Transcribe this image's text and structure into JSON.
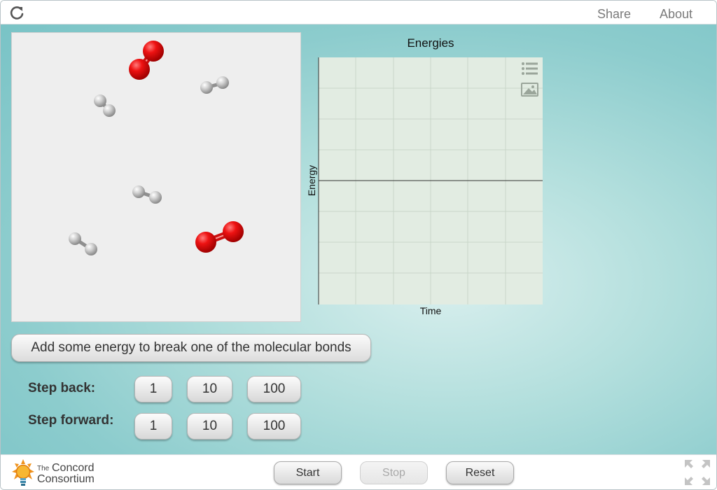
{
  "topbar": {
    "share_label": "Share",
    "about_label": "About"
  },
  "chart": {
    "title": "Energies",
    "xlabel": "Time",
    "ylabel": "Energy"
  },
  "chart_data": {
    "type": "line",
    "title": "Energies",
    "xlabel": "Time",
    "ylabel": "Energy",
    "series": [],
    "grid": true
  },
  "controls": {
    "action_label": "Add some energy to break one of the molecular bonds",
    "step_back_label": "Step back:",
    "step_forward_label": "Step forward:",
    "step_values": [
      "1",
      "10",
      "100"
    ]
  },
  "bottombar": {
    "logo_the": "The",
    "logo_concord": "Concord",
    "logo_consortium": "Consortium",
    "start_label": "Start",
    "stop_label": "Stop",
    "reset_label": "Reset"
  },
  "colors": {
    "oxygen": "#e01010",
    "hydrogen": "#bdbdbd",
    "background": "#8ccccd"
  }
}
